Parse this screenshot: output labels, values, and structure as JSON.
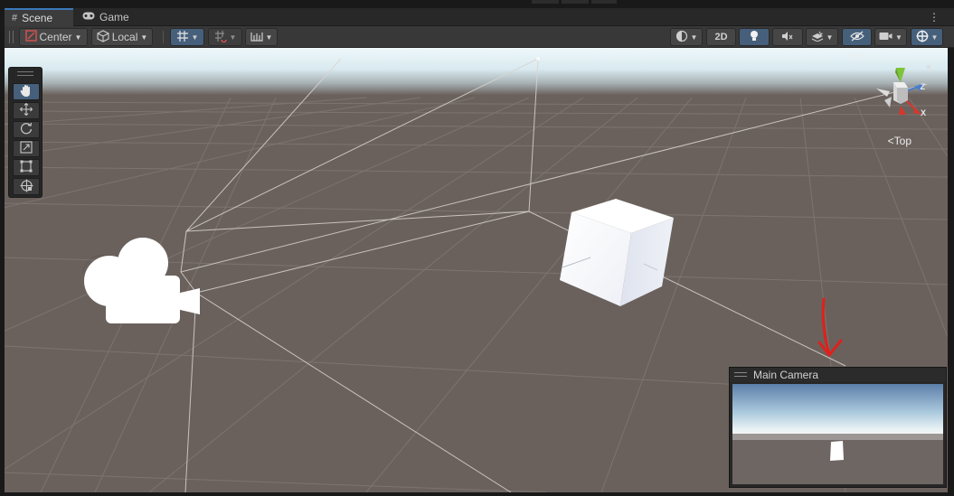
{
  "tabs": [
    {
      "label": "Scene",
      "icon": "grid-icon",
      "active": true
    },
    {
      "label": "Game",
      "icon": "gamepad-icon",
      "active": false
    }
  ],
  "toolbar": {
    "pivot_label": "Center",
    "space_label": "Local",
    "mode_2d_label": "2D"
  },
  "gizmo": {
    "view_label": "Top",
    "axis_z": "Z",
    "axis_x": "X"
  },
  "camera_preview": {
    "title": "Main Camera"
  },
  "colors": {
    "accent": "#3a79bb",
    "selected_button": "#46607c",
    "ground": "#6a615d",
    "sky": "#eaf4f8",
    "annotation_arrow": "#e0201b"
  }
}
